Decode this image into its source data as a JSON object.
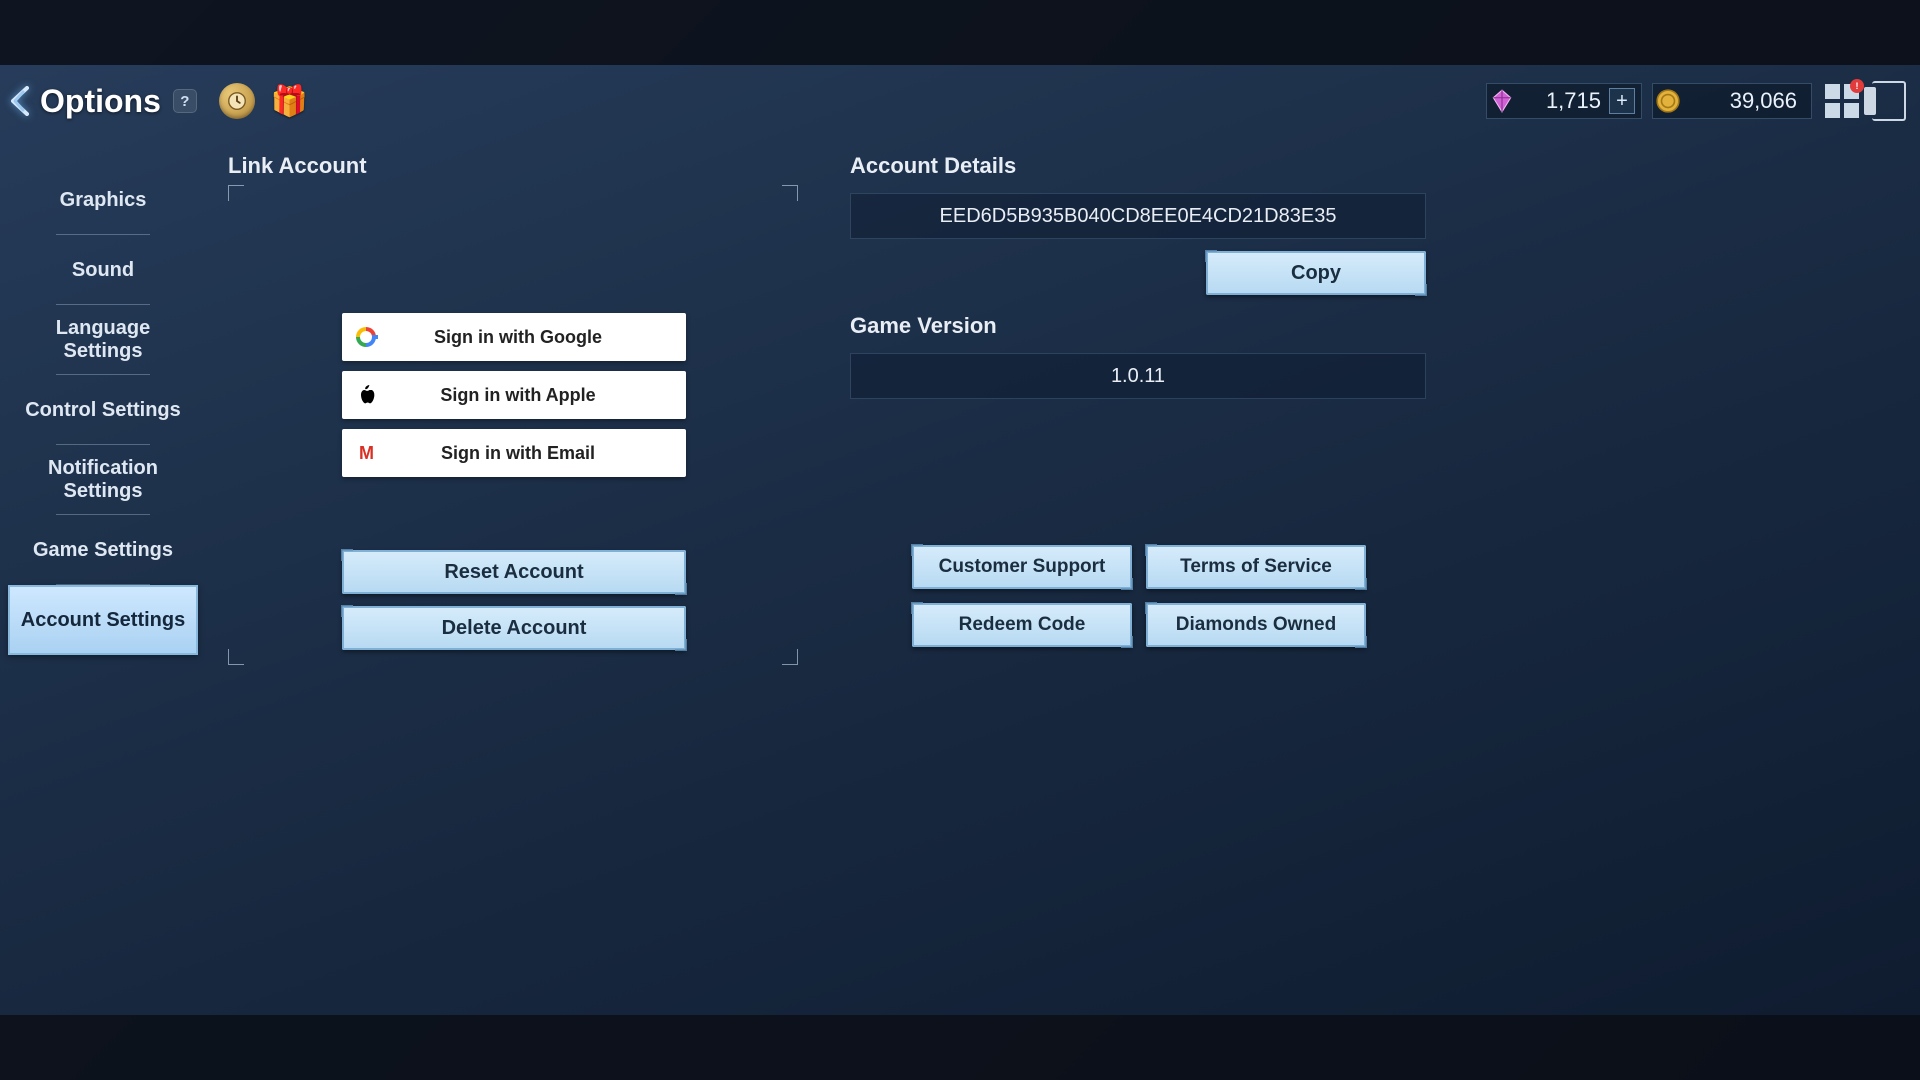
{
  "header": {
    "title": "Options",
    "help_label": "?",
    "currency1_amount": "1,715",
    "currency2_amount": "39,066",
    "notif_count": "!"
  },
  "sidebar": {
    "tabs": [
      {
        "label": "Graphics",
        "name": "tab-graphics"
      },
      {
        "label": "Sound",
        "name": "tab-sound"
      },
      {
        "label": "Language Settings",
        "name": "tab-language"
      },
      {
        "label": "Control Settings",
        "name": "tab-control"
      },
      {
        "label": "Notification Settings",
        "name": "tab-notification"
      },
      {
        "label": "Game Settings",
        "name": "tab-game"
      },
      {
        "label": "Account Settings",
        "name": "tab-account"
      }
    ],
    "active_index": 6
  },
  "link_account": {
    "title": "Link Account",
    "google": "Sign in with Google",
    "apple": "Sign in with Apple",
    "email": "Sign in with Email",
    "reset": "Reset Account",
    "delete": "Delete Account"
  },
  "account_details": {
    "title": "Account Details",
    "id": "EED6D5B935B040CD8EE0E4CD21D83E35",
    "copy": "Copy",
    "version_title": "Game Version",
    "version": "1.0.11"
  },
  "buttons": {
    "support": "Customer Support",
    "tos": "Terms of Service",
    "redeem": "Redeem Code",
    "diamonds": "Diamonds Owned"
  }
}
